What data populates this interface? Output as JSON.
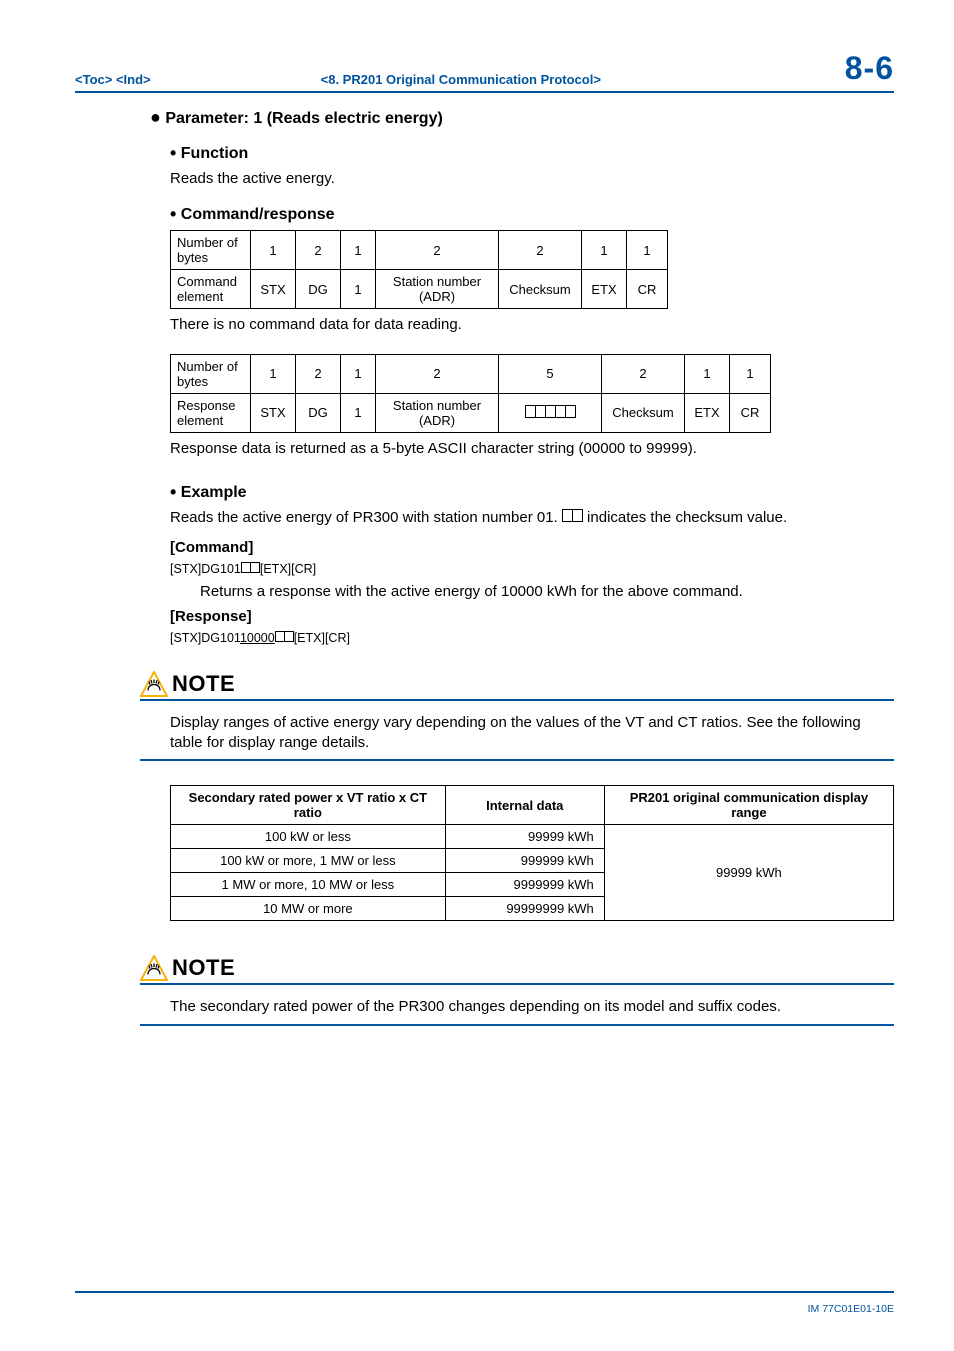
{
  "header": {
    "left": "<Toc> <Ind>",
    "mid": "<8.  PR201 Original Communication Protocol>",
    "right": "8-6"
  },
  "param_title": "Parameter: 1 (Reads electric energy)",
  "function": {
    "title": "Function",
    "text": "Reads the active energy."
  },
  "cmdresp": {
    "title": "Command/response",
    "cmd_table": {
      "bytes_label": "Number of bytes",
      "bytes": [
        "1",
        "2",
        "1",
        "2",
        "2",
        "1",
        "1"
      ],
      "elem_label": "Command element",
      "elems": [
        "STX",
        "DG",
        "1",
        "Station number (ADR)",
        "Checksum",
        "ETX",
        "CR"
      ]
    },
    "cmd_note": "There is no command data for data reading.",
    "resp_table": {
      "bytes_label": "Number of bytes",
      "bytes": [
        "1",
        "2",
        "1",
        "2",
        "5",
        "2",
        "1",
        "1"
      ],
      "elem_label": "Response element",
      "elems": [
        "STX",
        "DG",
        "1",
        "Station number (ADR)",
        "",
        "Checksum",
        "ETX",
        "CR"
      ]
    },
    "resp_note": "Response data is returned as a 5-byte ASCII character string (00000 to 99999)."
  },
  "example": {
    "title": "Example",
    "intro_a": "Reads the active energy of PR300 with station number 01. ",
    "intro_b": " indicates the checksum value.",
    "cmd_label": "[Command]",
    "cmd_line_a": "[STX]DG101",
    "cmd_line_b": "[ETX][CR]",
    "returns": "Returns a response with the active energy of 10000 kWh for the above command.",
    "resp_label": "[Response]",
    "resp_line_a": "[STX]DG101",
    "resp_line_u": "10000",
    "resp_line_b": "[ETX][CR]"
  },
  "note1": {
    "title": "NOTE",
    "text": "Display ranges of active energy vary depending on the values of the VT and CT ratios. See the following table for display range details."
  },
  "range_table": {
    "h1": "Secondary rated power x VT ratio x CT ratio",
    "h2": "Internal data",
    "h3": "PR201 original communication display range",
    "rows": [
      {
        "a": "100 kW or less",
        "b": "99999 kWh"
      },
      {
        "a": "100 kW or more, 1 MW or less",
        "b": "999999 kWh"
      },
      {
        "a": "1 MW or more, 10 MW or less",
        "b": "9999999 kWh"
      },
      {
        "a": "10 MW or more",
        "b": "99999999 kWh"
      }
    ],
    "c_merged": "99999 kWh"
  },
  "note2": {
    "title": "NOTE",
    "text": "The secondary rated power of the PR300 changes depending on its model and suffix codes."
  },
  "footer": "IM 77C01E01-10E"
}
